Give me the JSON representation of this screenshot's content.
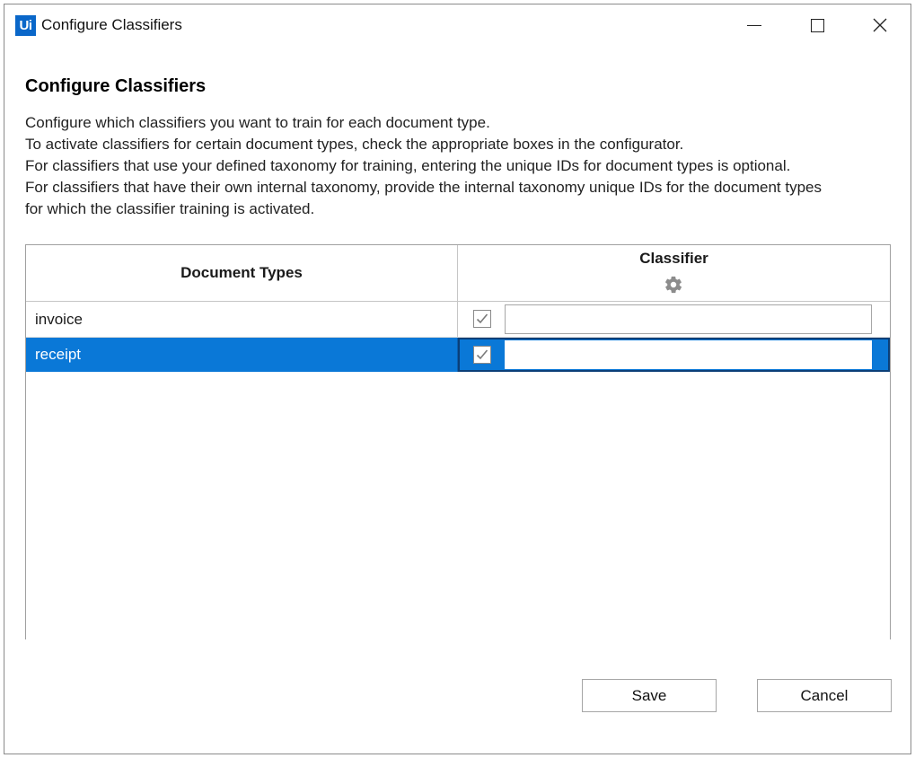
{
  "window": {
    "logo_text": "Ui",
    "title": "Configure Classifiers"
  },
  "heading": "Configure Classifiers",
  "description": [
    "Configure which classifiers you want to train for each document type.",
    "To activate classifiers for certain document types, check the appropriate boxes in the configurator.",
    "For classifiers that use your defined taxonomy for training, entering the unique IDs for document types is optional.",
    "For classifiers that have their own internal taxonomy, provide the internal taxonomy unique IDs for the document types",
    "for which the classifier training is activated."
  ],
  "grid": {
    "columns": {
      "document_types": "Document Types",
      "classifier": "Classifier",
      "classifier_icon": "gear-icon"
    },
    "rows": [
      {
        "document_type": "invoice",
        "checked": true,
        "unique_id": "",
        "selected": false
      },
      {
        "document_type": "receipt",
        "checked": true,
        "unique_id": "",
        "selected": true
      }
    ]
  },
  "buttons": {
    "save": "Save",
    "cancel": "Cancel"
  },
  "colors": {
    "selection": "#0a78d7",
    "logo": "#0a67c9"
  }
}
